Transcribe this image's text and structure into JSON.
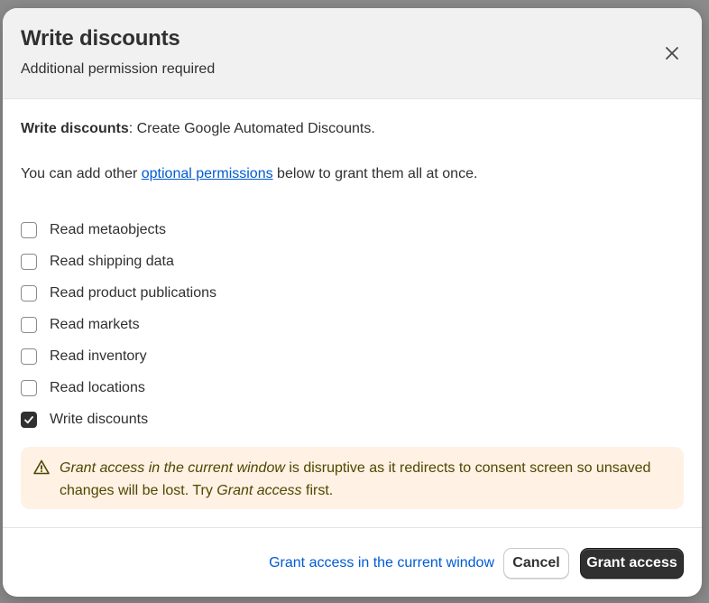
{
  "dialog": {
    "title": "Write discounts",
    "subtitle": "Additional permission required"
  },
  "description": {
    "scope_name": "Write discounts",
    "scope_text": ": Create Google Automated Discounts.",
    "optional_prefix": "You can add other ",
    "optional_link": "optional permissions",
    "optional_suffix": " below to grant them all at once."
  },
  "permissions": [
    {
      "label": "Read metaobjects",
      "checked": false
    },
    {
      "label": "Read shipping data",
      "checked": false
    },
    {
      "label": "Read product publications",
      "checked": false
    },
    {
      "label": "Read markets",
      "checked": false
    },
    {
      "label": "Read inventory",
      "checked": false
    },
    {
      "label": "Read locations",
      "checked": false
    },
    {
      "label": "Write discounts",
      "checked": true
    }
  ],
  "warning": {
    "icon": "warning-triangle-icon",
    "emphasis": "Grant access in the current window",
    "text_middle": " is disruptive as it redirects to consent screen so unsaved changes will be lost. Try ",
    "emphasis_2": "Grant access",
    "text_end": " first."
  },
  "footer": {
    "current_window_link": "Grant access in the current window",
    "cancel_label": "Cancel",
    "grant_label": "Grant access"
  },
  "colors": {
    "primary_button": "#303030",
    "link": "#005bd3",
    "warning_bg": "#fff1e3"
  }
}
